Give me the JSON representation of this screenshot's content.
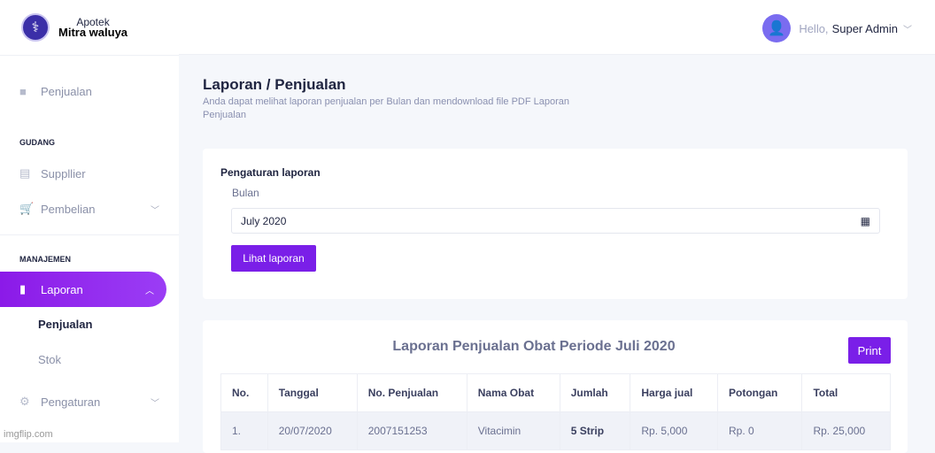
{
  "brand": {
    "line1": "Apotek",
    "line2": "Mitra waluya"
  },
  "sidebar": {
    "items": [
      {
        "label": "Penjualan",
        "icon": "bag-icon"
      }
    ],
    "gudang": {
      "title": "GUDANG",
      "items": [
        {
          "label": "Suppllier"
        },
        {
          "label": "Pembelian"
        }
      ]
    },
    "manajemen": {
      "title": "MANAJEMEN",
      "laporan": "Laporan",
      "sub": [
        "Penjualan",
        "Stok"
      ],
      "pengaturan": "Pengaturan"
    }
  },
  "header": {
    "hello": "Hello,",
    "user": "Super Admin"
  },
  "page": {
    "title": "Laporan / Penjualan",
    "subtitle": "Anda dapat melihat laporan penjualan per Bulan dan mendownload file PDF Laporan Penjualan"
  },
  "settings": {
    "title": "Pengaturan laporan",
    "label": "Bulan",
    "value": "July 2020",
    "button": "Lihat laporan"
  },
  "report": {
    "title": "Laporan Penjualan Obat Periode Juli 2020",
    "print": "Print",
    "columns": [
      "No.",
      "Tanggal",
      "No. Penjualan",
      "Nama Obat",
      "Jumlah",
      "Harga jual",
      "Potongan",
      "Total"
    ],
    "rows": [
      [
        "1.",
        "20/07/2020",
        "2007151253",
        "Vitacimin",
        "5 Strip",
        "Rp. 5,000",
        "Rp. 0",
        "Rp. 25,000"
      ]
    ]
  },
  "watermark": "imgflip.com"
}
